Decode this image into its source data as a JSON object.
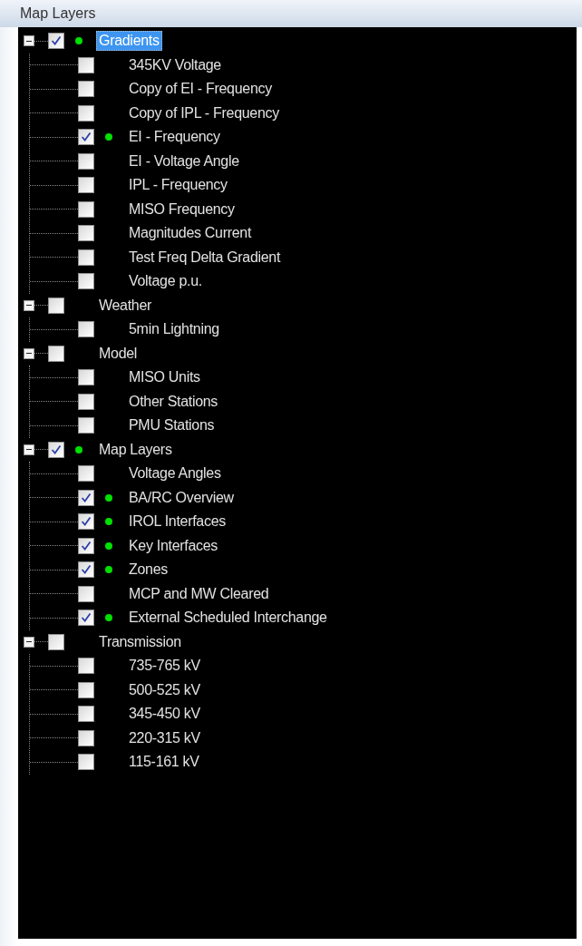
{
  "window": {
    "title": "Map Layers"
  },
  "tree": [
    {
      "label": "Gradients",
      "checked": true,
      "selected": true,
      "expanded": true,
      "children": [
        {
          "label": "345KV Voltage",
          "checked": false,
          "selected": false
        },
        {
          "label": "Copy of EI - Frequency",
          "checked": false,
          "selected": false
        },
        {
          "label": "Copy of IPL - Frequency",
          "checked": false,
          "selected": false
        },
        {
          "label": "EI - Frequency",
          "checked": true,
          "selected": false
        },
        {
          "label": "EI - Voltage Angle",
          "checked": false,
          "selected": false
        },
        {
          "label": "IPL - Frequency",
          "checked": false,
          "selected": false
        },
        {
          "label": "MISO Frequency",
          "checked": false,
          "selected": false
        },
        {
          "label": "Magnitudes Current",
          "checked": false,
          "selected": false
        },
        {
          "label": "Test Freq Delta Gradient",
          "checked": false,
          "selected": false
        },
        {
          "label": "Voltage p.u.",
          "checked": false,
          "selected": false
        }
      ]
    },
    {
      "label": "Weather",
      "checked": false,
      "selected": false,
      "expanded": true,
      "children": [
        {
          "label": "5min Lightning",
          "checked": false,
          "selected": false
        }
      ]
    },
    {
      "label": "Model",
      "checked": false,
      "selected": false,
      "expanded": true,
      "children": [
        {
          "label": "MISO Units",
          "checked": false,
          "selected": false
        },
        {
          "label": "Other Stations",
          "checked": false,
          "selected": false
        },
        {
          "label": "PMU Stations",
          "checked": false,
          "selected": false
        }
      ]
    },
    {
      "label": "Map Layers",
      "checked": true,
      "selected": false,
      "expanded": true,
      "children": [
        {
          "label": "Voltage Angles",
          "checked": false,
          "selected": false
        },
        {
          "label": "BA/RC Overview",
          "checked": true,
          "selected": false
        },
        {
          "label": "IROL Interfaces",
          "checked": true,
          "selected": false
        },
        {
          "label": "Key Interfaces",
          "checked": true,
          "selected": false
        },
        {
          "label": "Zones",
          "checked": true,
          "selected": false
        },
        {
          "label": "MCP and MW Cleared",
          "checked": false,
          "selected": false
        },
        {
          "label": "External Scheduled Interchange",
          "checked": true,
          "selected": false
        }
      ]
    },
    {
      "label": "Transmission",
      "checked": false,
      "selected": false,
      "expanded": true,
      "children": [
        {
          "label": "735-765 kV",
          "checked": false,
          "selected": false
        },
        {
          "label": "500-525 kV",
          "checked": false,
          "selected": false
        },
        {
          "label": "345-450 kV",
          "checked": false,
          "selected": false
        },
        {
          "label": "220-315 kV",
          "checked": false,
          "selected": false
        },
        {
          "label": "115-161 kV",
          "checked": false,
          "selected": false
        }
      ]
    }
  ]
}
